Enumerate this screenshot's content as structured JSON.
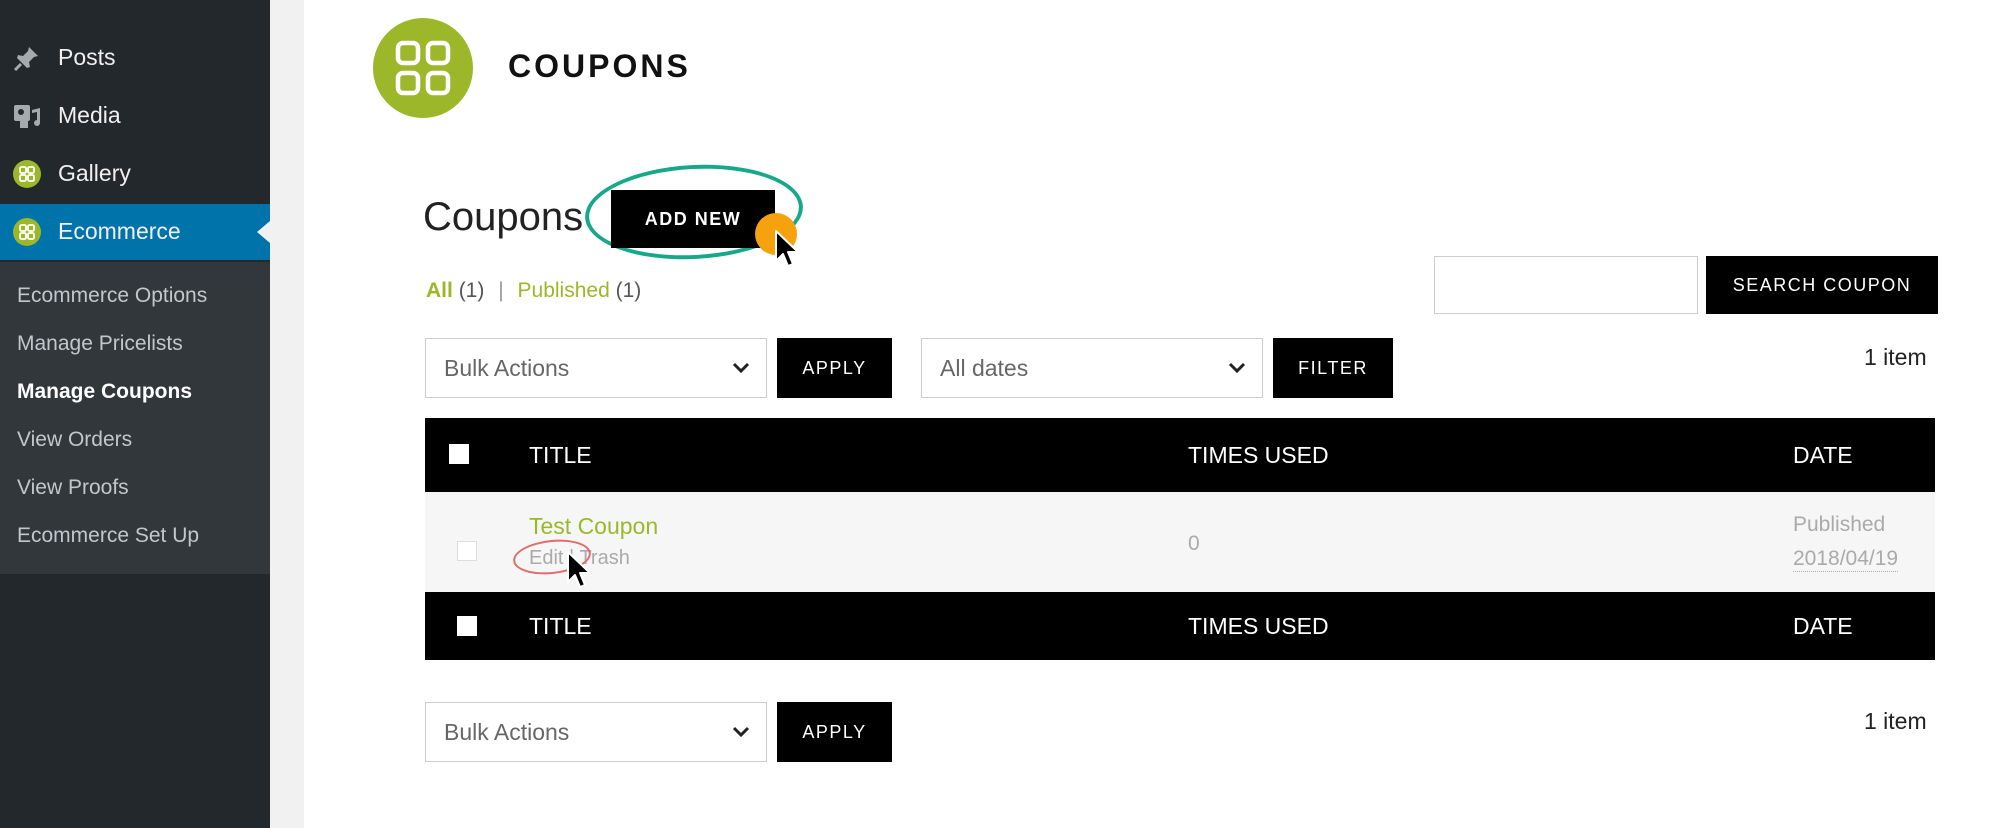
{
  "sidebar": {
    "menu": [
      {
        "label": "Posts",
        "icon": "pushpin-icon"
      },
      {
        "label": "Media",
        "icon": "media-icon"
      },
      {
        "label": "Gallery",
        "icon": "gallery-grid-icon"
      },
      {
        "label": "Ecommerce",
        "icon": "ecommerce-grid-icon"
      }
    ],
    "submenu": [
      "Ecommerce Options",
      "Manage Pricelists",
      "Manage Coupons",
      "View Orders",
      "View Proofs",
      "Ecommerce Set Up"
    ],
    "current_submenu": "Manage Coupons"
  },
  "header": {
    "title": "COUPONS",
    "logo_icon": "grid-icon"
  },
  "page": {
    "heading": "Coupons",
    "add_new_label": "ADD NEW"
  },
  "views": {
    "all_label": "All",
    "all_count": "(1)",
    "separator": "|",
    "published_label": "Published",
    "published_count": "(1)"
  },
  "search": {
    "value": "",
    "button_label": "SEARCH COUPON"
  },
  "filters": {
    "bulk_actions": "Bulk Actions",
    "apply_label": "APPLY",
    "dates": "All dates",
    "filter_label": "FILTER",
    "item_count": "1 item"
  },
  "table": {
    "columns": {
      "title": "TITLE",
      "times_used": "TIMES USED",
      "date": "DATE"
    },
    "rows": [
      {
        "title": "Test Coupon",
        "edit": "Edit",
        "action_sep": "|",
        "trash": "Trash",
        "times_used": "0",
        "status": "Published",
        "date": "2018/04/19"
      }
    ]
  },
  "colors": {
    "accent_green": "#9cb82a",
    "wp_blue": "#0073aa",
    "highlight_teal": "#17a88a",
    "pointer_orange": "#f5a20e",
    "edit_circle_red": "#e06b6b"
  }
}
